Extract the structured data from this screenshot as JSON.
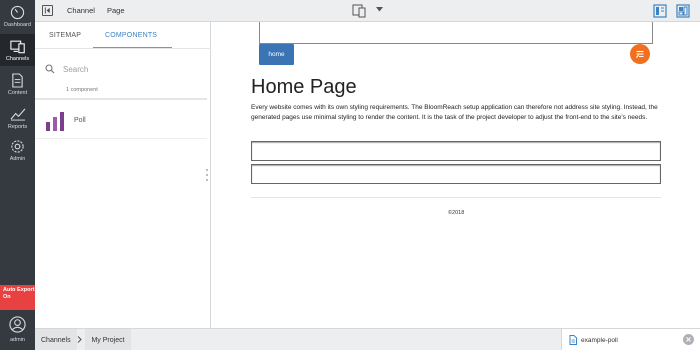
{
  "nav": {
    "items": [
      {
        "label": "Dashboard",
        "icon": "dashboard-icon"
      },
      {
        "label": "Channels",
        "icon": "channels-icon",
        "active": true
      },
      {
        "label": "Content",
        "icon": "content-icon"
      },
      {
        "label": "Reports",
        "icon": "reports-icon"
      },
      {
        "label": "Admin",
        "icon": "admin-gear-icon"
      }
    ],
    "auto_export": "Auto Export On",
    "user_label": "admin"
  },
  "topbar": {
    "channel_label": "Channel",
    "page_label": "Page"
  },
  "panel": {
    "tabs": [
      {
        "label": "SITEMAP",
        "active": false
      },
      {
        "label": "COMPONENTS",
        "active": true
      }
    ],
    "search_placeholder": "Search",
    "count_text": "1 component",
    "components": [
      {
        "name": "Poll",
        "icon": "poll-bar-chart-icon"
      }
    ]
  },
  "preview": {
    "home_button": "home",
    "title": "Home Page",
    "body": "Every website comes with its own styling requirements. The BloomReach setup application can therefore not address site styling. Instead, the generated pages use minimal styling to render the content. It is the task of the project developer to adjust the front-end to the site's needs.",
    "copyright": "©2018"
  },
  "bottombar": {
    "breadcrumbs": [
      "Channels",
      "My Project"
    ],
    "document_tab": "example-poll"
  },
  "colors": {
    "nav_bg": "#353a40",
    "accent_blue": "#3b84c4",
    "tab_underline": "#e07c3a",
    "home_button": "#3b74b4",
    "orange_button": "#f1701f",
    "export_red": "#e84142",
    "poll_icon": "#7b3f8c"
  }
}
